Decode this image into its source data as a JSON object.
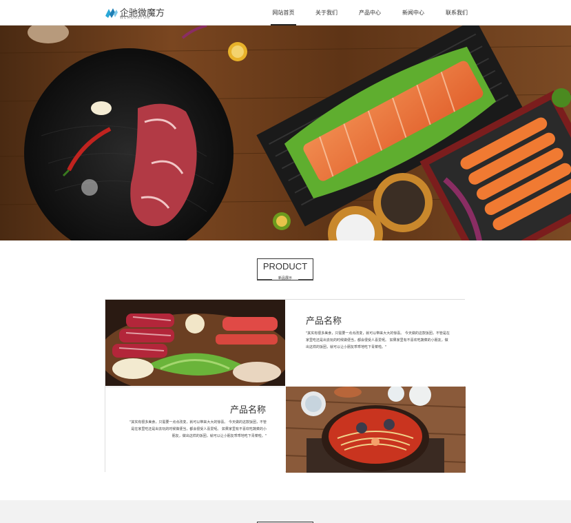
{
  "brand": {
    "name": "企驰微魔方",
    "tagline": "WEMOREFUN"
  },
  "nav": {
    "items": [
      {
        "label": "网站首页",
        "active": true
      },
      {
        "label": "关于我们",
        "active": false
      },
      {
        "label": "产品中心",
        "active": false
      },
      {
        "label": "新闻中心",
        "active": false
      },
      {
        "label": "联系我们",
        "active": false
      }
    ]
  },
  "product_section": {
    "title": "PRODUCT",
    "subtitle": "新品展示"
  },
  "products": [
    {
      "name": "产品名称",
      "description": "\"其实有很多美食，只需要一点点改变，就可以带来大大的惊喜。 今天做的这款饭团，不管是在家里吃还是出去玩的时候做便当，都会很受人喜爱呢。 如果家里有不喜欢吃蔬菜的小朋友，做出这样的饭团，就可以让小朋友乖乖地吃下青菜啦。\""
    },
    {
      "name": "产品名称",
      "description": "\"其实有很多美食，只需要一点点改变，就可以带来大大的惊喜。 今天做的这款饭团，不管是在家里吃还是出去玩的时候做便当，都会很受人喜爱呢。 如果家里有不喜欢吃蔬菜的小朋友，做出这样的饭团，就可以让小朋友乖乖地吃下青菜啦。\""
    }
  ],
  "colors": {
    "accent": "#222222",
    "wood": "#6b3d1c",
    "footer_band": "#f2f2f2"
  }
}
